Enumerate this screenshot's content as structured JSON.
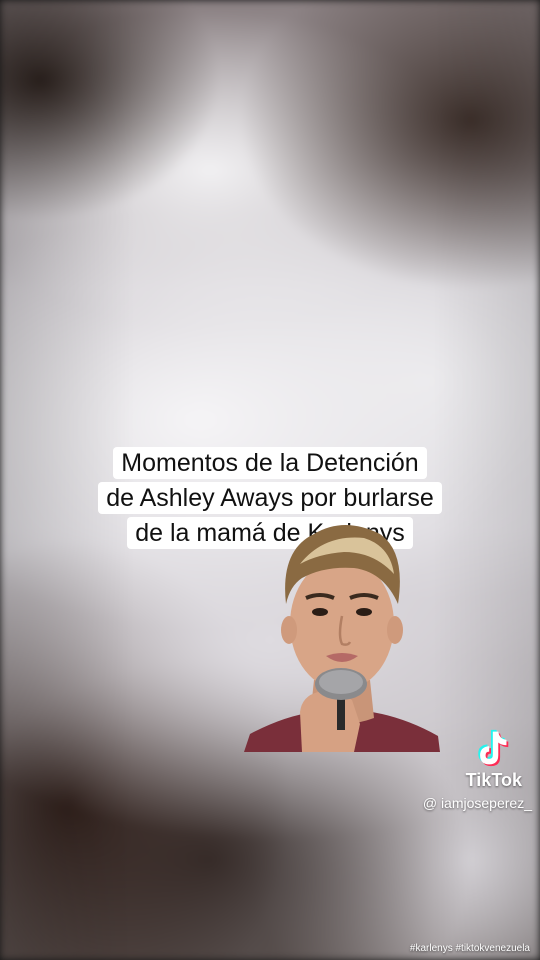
{
  "caption": {
    "lines": [
      "Momentos de la Detención",
      "de Ashley Aways por burlarse",
      "de la mamá de Karlenys"
    ]
  },
  "watermark": {
    "icon": "tiktok-logo-icon",
    "brand": "TikTok",
    "username": "@ iamjoseperez_"
  },
  "hashtags": "#karlenys #tiktokvenezuela",
  "colors": {
    "caption_bg": "#ffffff",
    "caption_text": "#111111",
    "tiktok_cyan": "#25f4ee",
    "tiktok_red": "#fe2c55"
  }
}
